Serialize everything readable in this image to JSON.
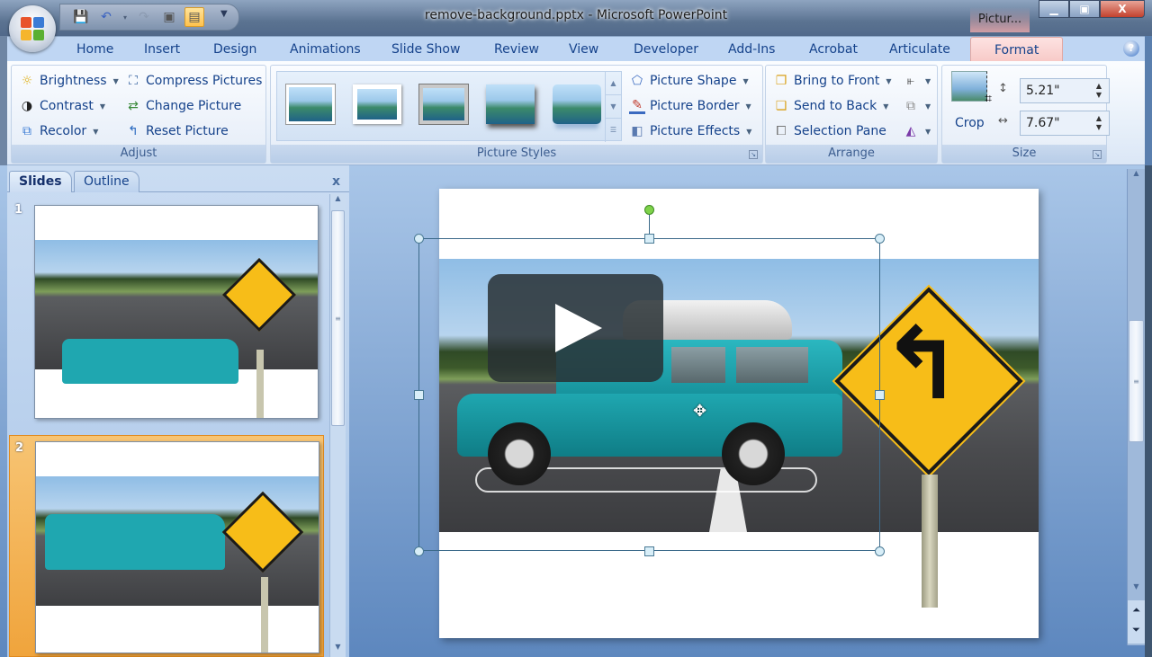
{
  "window": {
    "title": "remove-background.pptx - Microsoft PowerPoint",
    "contextual_tab_group": "Pictur...",
    "controls": {
      "minimize": "minimize",
      "maximize": "maximize",
      "close": "X"
    }
  },
  "quick_access": {
    "items": [
      {
        "name": "save",
        "icon": "floppy-disk-icon"
      },
      {
        "name": "undo",
        "icon": "undo-icon"
      },
      {
        "name": "undo-dropdown",
        "icon": "chevron-down-icon"
      },
      {
        "name": "redo",
        "icon": "redo-icon"
      },
      {
        "name": "view-normal",
        "icon": "slide-view-icon"
      },
      {
        "name": "view-presentation",
        "icon": "notes-view-icon"
      }
    ],
    "customize": "customize-qat-icon"
  },
  "ribbon_tabs": [
    "Home",
    "Insert",
    "Design",
    "Animations",
    "Slide Show",
    "Review",
    "View",
    "Developer",
    "Add-Ins",
    "Acrobat",
    "Articulate",
    "Format"
  ],
  "active_tab": "Format",
  "ribbon": {
    "adjust": {
      "label": "Adjust",
      "brightness": "Brightness",
      "contrast": "Contrast",
      "recolor": "Recolor",
      "compress": "Compress Pictures",
      "change": "Change Picture",
      "reset": "Reset Picture"
    },
    "picture_styles": {
      "label": "Picture Styles",
      "styles_count": 5,
      "shape": "Picture Shape",
      "border": "Picture Border",
      "effects": "Picture Effects"
    },
    "arrange": {
      "label": "Arrange",
      "bring_front": "Bring to Front",
      "send_back": "Send to Back",
      "selection_pane": "Selection Pane"
    },
    "size": {
      "label": "Size",
      "crop": "Crop",
      "height": "5.21\"",
      "width": "7.67\""
    }
  },
  "slides_pane": {
    "tabs": [
      "Slides",
      "Outline"
    ],
    "active": "Slides",
    "close": "x",
    "slides": [
      {
        "number": "1",
        "selected": false
      },
      {
        "number": "2",
        "selected": true
      }
    ]
  },
  "editor": {
    "overlay": "play-button",
    "cursor": "move-cursor"
  }
}
